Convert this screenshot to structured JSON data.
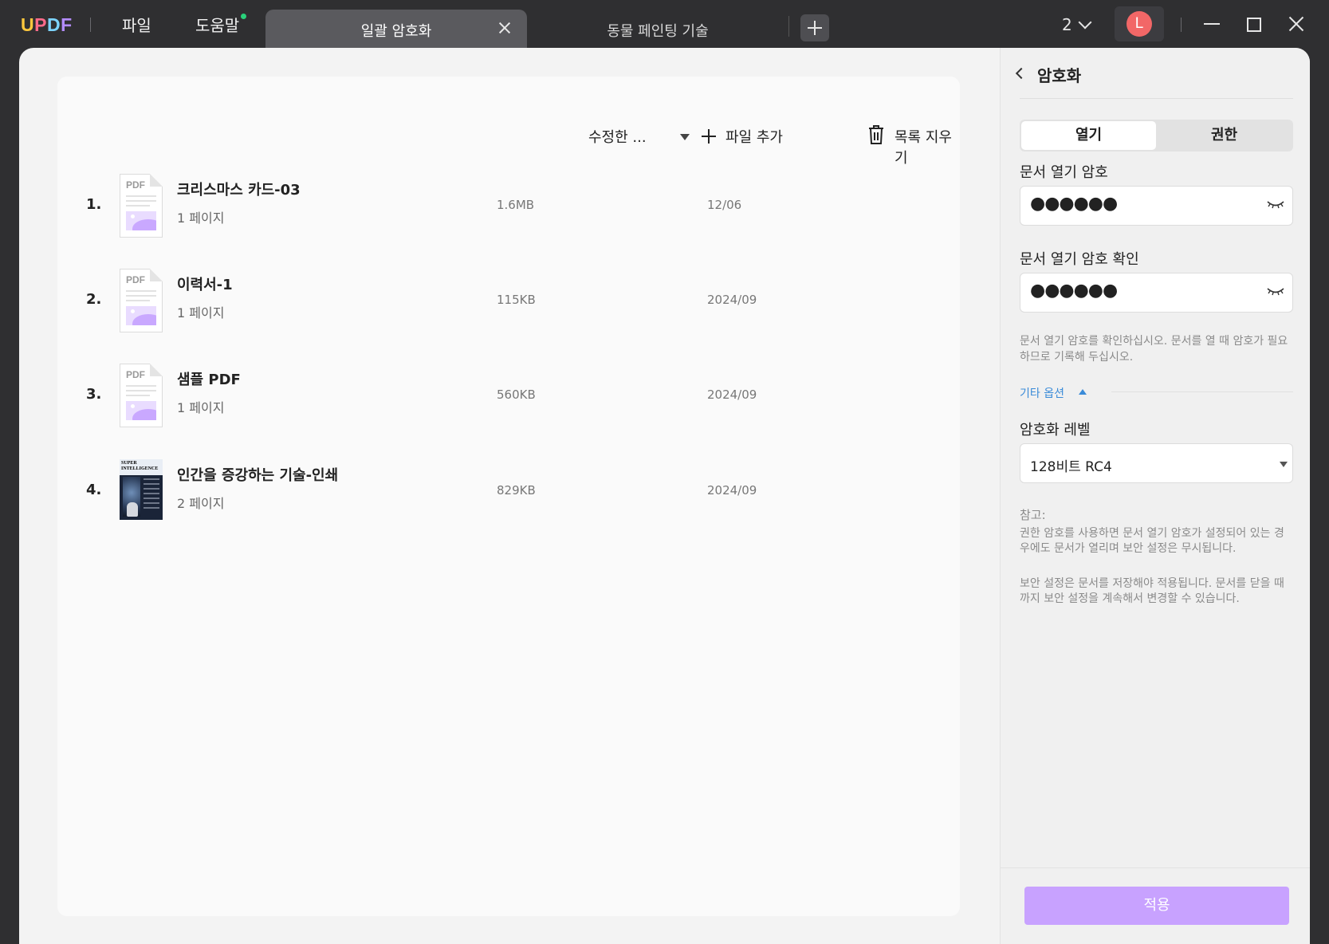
{
  "app": {
    "logo": "UPDF",
    "menu": [
      "파일",
      "도움말"
    ]
  },
  "tabs": {
    "active": "일괄 암호화",
    "inactive": "동물 페인팅 기술"
  },
  "titlebar": {
    "window_count": "2",
    "avatar_initial": "L"
  },
  "toolbar": {
    "sort_label": "수정한 ...",
    "add_file": "파일 추가",
    "clear_list": "목록 지우기"
  },
  "files": [
    {
      "num": "1.",
      "name": "크리스마스 카드-03",
      "pages": "1 페이지",
      "size": "1.6MB",
      "date": "12/06",
      "thumb": "pdf"
    },
    {
      "num": "2.",
      "name": "이력서-1",
      "pages": "1 페이지",
      "size": "115KB",
      "date": "2024/09",
      "thumb": "pdf"
    },
    {
      "num": "3.",
      "name": "샘플 PDF",
      "pages": "1 페이지",
      "size": "560KB",
      "date": "2024/09",
      "thumb": "pdf"
    },
    {
      "num": "4.",
      "name": "인간을 증강하는 기술-인쇄",
      "pages": "2 페이지",
      "size": "829KB",
      "date": "2024/09",
      "thumb": "book",
      "cover_text": "SUPER INTELLIGENCE"
    }
  ],
  "thumb_pdf_label": "PDF",
  "panel": {
    "title": "암호화",
    "seg_open": "열기",
    "seg_perm": "권한",
    "open_pw_label": "문서 열기 암호",
    "open_pw_value": "●●●●●●",
    "confirm_pw_label": "문서 열기 암호 확인",
    "confirm_pw_value": "●●●●●●",
    "hint": "문서 열기 암호를 확인하십시오. 문서를 열 때 암호가 필요하므로 기록해 두십시오.",
    "more_options": "기타 옵션",
    "level_label": "암호화 레벨",
    "level_value": "128비트 RC4",
    "note_title": "참고:",
    "note1": "권한 암호를 사용하면 문서 열기 암호가 설정되어 있는 경우에도 문서가 열리며 보안 설정은 무시됩니다.",
    "note2": "보안 설정은 문서를 저장해야 적용됩니다. 문서를 닫을 때까지 보안 설정을 계속해서 변경할 수 있습니다.",
    "apply": "적용"
  }
}
